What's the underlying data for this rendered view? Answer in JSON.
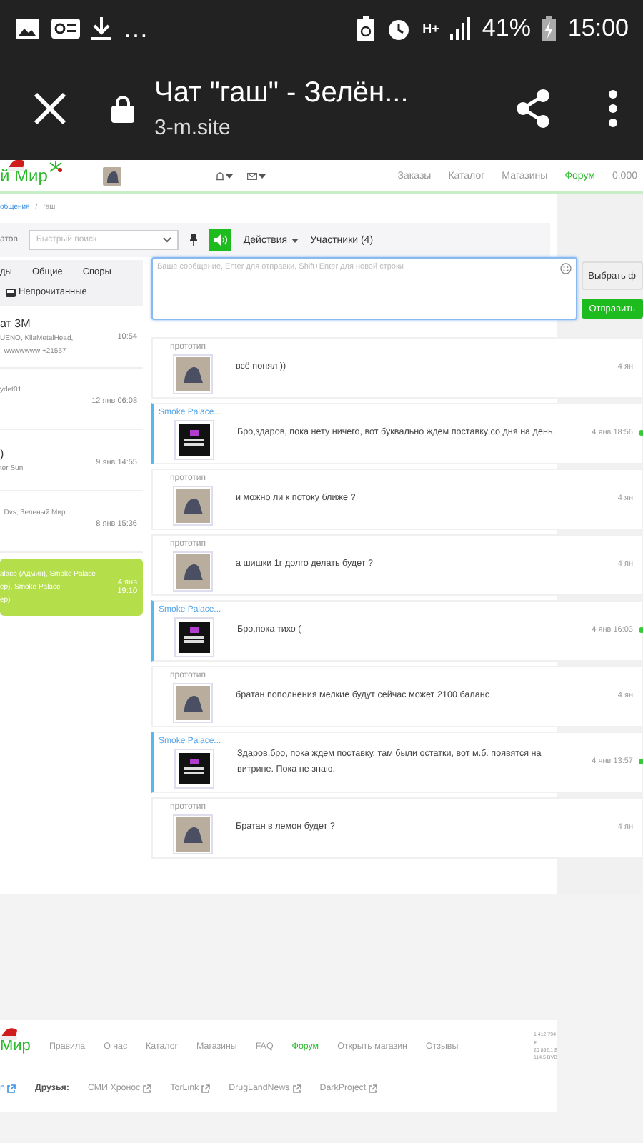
{
  "status_bar": {
    "more": "…",
    "network": "H+",
    "battery": "41%",
    "time": "15:00"
  },
  "browser": {
    "title": "Чат \"гаш\" - Зелён...",
    "url": "3-m.site"
  },
  "header": {
    "logo": "й Мир",
    "nav": [
      {
        "label": "Заказы",
        "selected": false
      },
      {
        "label": "Каталог",
        "selected": false
      },
      {
        "label": "Магазины",
        "selected": false
      },
      {
        "label": "Форум",
        "selected": true
      }
    ],
    "balance": "0.000"
  },
  "breadcrumb": {
    "parent": "общения",
    "separator": "/",
    "current": "гаш"
  },
  "toolbar": {
    "label": "атов",
    "search_placeholder": "Быстрый поиск",
    "sound_on": true,
    "actions": "Действия",
    "participants": "Участники (4)"
  },
  "chat_list": {
    "tabs": [
      {
        "label": "ды",
        "selected": false
      },
      {
        "label": "Общие",
        "selected": false
      },
      {
        "label": "Споры",
        "selected": false
      }
    ],
    "filter": "Непрочитанные",
    "items": [
      {
        "title": "ат 3М",
        "lines": [
          "UENO, KllaMetalHead,",
          ", wwwwwww +21557"
        ],
        "time": "10:54",
        "selected": false
      },
      {
        "lines": [
          "ydet01"
        ],
        "time": "12 янв 06:08",
        "selected": false
      },
      {
        "title": ")",
        "lines": [
          "ter Sun"
        ],
        "time": "9 янв 14:55",
        "selected": false
      },
      {
        "lines": [
          ", Dvs, Зеленый Мир"
        ],
        "time": "8 янв 15:36",
        "selected": false
      },
      {
        "lines": [
          "alace (Админ), Smoke Palace",
          "ер), Smoke Palace",
          "ер)"
        ],
        "time": "4 янв 19:10",
        "selected": true
      }
    ]
  },
  "composer": {
    "placeholder": "Ваше сообщение, Enter для отправки, Shift+Enter для новой строки",
    "file_button": "Выбрать ф",
    "send_button": "Отправить"
  },
  "messages": [
    {
      "kind": "user",
      "author": "прототип",
      "text": "всё понял ))",
      "time": "4 ян"
    },
    {
      "kind": "shop",
      "author": "Smoke Palace...",
      "text": "Бро,здаров, пока нету ничего, вот буквально ждем поставку со дня на день.",
      "time": "4 янв 18:56"
    },
    {
      "kind": "user",
      "author": "прототип",
      "text": "и можно ли к потоку ближе ?",
      "time": "4 ян"
    },
    {
      "kind": "user",
      "author": "прототип",
      "text": "а шишки 1г долго делать будет ?",
      "time": "4 ян"
    },
    {
      "kind": "shop",
      "author": "Smoke Palace...",
      "text": "Бро,пока тихо (",
      "time": "4 янв 16:03"
    },
    {
      "kind": "user",
      "author": "прототип",
      "text": "братан пополнения мелкие будут сейчас может 2100 баланс",
      "time": "4 ян"
    },
    {
      "kind": "shop",
      "author": "Smoke Palace...",
      "text": "Здаров,бро, пока ждем поставку, там были остатки, вот м.б. появятся на витрине. Пока не знаю.",
      "time": "4 янв 13:57"
    },
    {
      "kind": "user",
      "author": "прототип",
      "text": "Братан в лемон будет ?",
      "time": "4 ян"
    }
  ],
  "footer": {
    "logo": "Мир",
    "links": [
      {
        "label": "Правила",
        "selected": false
      },
      {
        "label": "О нас",
        "selected": false
      },
      {
        "label": "Каталог",
        "selected": false
      },
      {
        "label": "Магазины",
        "selected": false
      },
      {
        "label": "FAQ",
        "selected": false
      },
      {
        "label": "Форум",
        "selected": true
      },
      {
        "label": "Открыть магазин",
        "selected": false
      },
      {
        "label": "Отзывы",
        "selected": false
      }
    ],
    "stats": [
      "1 412 794",
      "₽",
      "20 892.1 $",
      "114.5 BVB"
    ],
    "first_link": "n",
    "friends_label": "Друзья:",
    "friends": [
      "СМИ Хронос",
      "TorLink",
      "DrugLandNews",
      "DarkProject"
    ]
  }
}
